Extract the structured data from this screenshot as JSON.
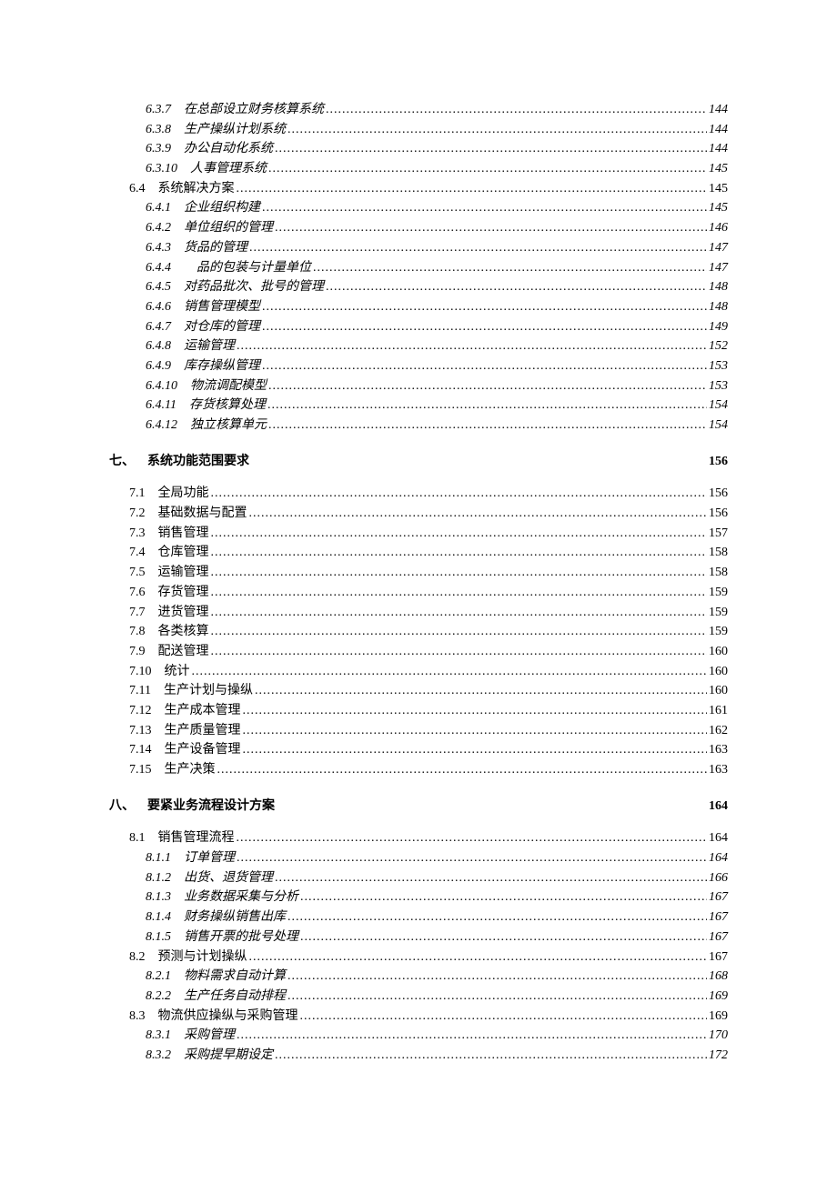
{
  "toc": [
    {
      "level": 3,
      "italic": true,
      "num": "6.3.7",
      "title": "在总部设立财务核算系统",
      "page": "144"
    },
    {
      "level": 3,
      "italic": true,
      "num": "6.3.8",
      "title": "生产操纵计划系统",
      "page": "144"
    },
    {
      "level": 3,
      "italic": true,
      "num": "6.3.9",
      "title": "办公自动化系统",
      "page": "144"
    },
    {
      "level": 3,
      "italic": true,
      "num": "6.3.10",
      "title": "人事管理系统",
      "page": "145"
    },
    {
      "level": 2,
      "italic": false,
      "num": "6.4",
      "title": "系统解决方案",
      "page": "145"
    },
    {
      "level": 3,
      "italic": true,
      "num": "6.4.1",
      "title": "企业组织构建",
      "page": "145"
    },
    {
      "level": 3,
      "italic": true,
      "num": "6.4.2",
      "title": "单位组织的管理",
      "page": "146"
    },
    {
      "level": 3,
      "italic": true,
      "num": "6.4.3",
      "title": "货品的管理",
      "page": "147"
    },
    {
      "level": 3,
      "italic": true,
      "num": "6.4.4",
      "title": "　品的包装与计量单位",
      "page": "147"
    },
    {
      "level": 3,
      "italic": true,
      "num": "6.4.5",
      "title": "对药品批次、批号的管理",
      "page": "148"
    },
    {
      "level": 3,
      "italic": true,
      "num": "6.4.6",
      "title": "销售管理模型",
      "page": "148"
    },
    {
      "level": 3,
      "italic": true,
      "num": "6.4.7",
      "title": "对仓库的管理",
      "page": "149"
    },
    {
      "level": 3,
      "italic": true,
      "num": "6.4.8",
      "title": "运输管理",
      "page": "152"
    },
    {
      "level": 3,
      "italic": true,
      "num": "6.4.9",
      "title": "库存操纵管理",
      "page": "153"
    },
    {
      "level": 3,
      "italic": true,
      "num": "6.4.10",
      "title": "物流调配模型",
      "page": "153"
    },
    {
      "level": 3,
      "italic": true,
      "num": "6.4.11",
      "title": "存货核算处理",
      "page": "154"
    },
    {
      "level": 3,
      "italic": true,
      "num": "6.4.12",
      "title": "独立核算单元",
      "page": "154"
    },
    {
      "level": 1,
      "italic": false,
      "num": "七、",
      "title": "系统功能范围要求",
      "page": "156",
      "gap": true
    },
    {
      "level": 2,
      "italic": false,
      "num": "7.1",
      "title": "全局功能",
      "page": "156",
      "gapafter": true
    },
    {
      "level": 2,
      "italic": false,
      "num": "7.2",
      "title": "基础数据与配置",
      "page": "156"
    },
    {
      "level": 2,
      "italic": false,
      "num": "7.3",
      "title": "销售管理",
      "page": "157"
    },
    {
      "level": 2,
      "italic": false,
      "num": "7.4",
      "title": "仓库管理",
      "page": "158"
    },
    {
      "level": 2,
      "italic": false,
      "num": "7.5",
      "title": "运输管理",
      "page": "158"
    },
    {
      "level": 2,
      "italic": false,
      "num": "7.6",
      "title": "存货管理",
      "page": "159"
    },
    {
      "level": 2,
      "italic": false,
      "num": "7.7",
      "title": "进货管理",
      "page": "159"
    },
    {
      "level": 2,
      "italic": false,
      "num": "7.8",
      "title": "各类核算",
      "page": "159"
    },
    {
      "level": 2,
      "italic": false,
      "num": "7.9",
      "title": "配送管理",
      "page": "160"
    },
    {
      "level": 2,
      "italic": false,
      "num": "7.10",
      "title": "统计",
      "page": "160"
    },
    {
      "level": 2,
      "italic": false,
      "num": "7.11",
      "title": "生产计划与操纵",
      "page": "160"
    },
    {
      "level": 2,
      "italic": false,
      "num": "7.12",
      "title": "生产成本管理",
      "page": "161"
    },
    {
      "level": 2,
      "italic": false,
      "num": "7.13",
      "title": "生产质量管理",
      "page": "162"
    },
    {
      "level": 2,
      "italic": false,
      "num": "7.14",
      "title": "生产设备管理",
      "page": "163"
    },
    {
      "level": 2,
      "italic": false,
      "num": "7.15",
      "title": "生产决策",
      "page": "163"
    },
    {
      "level": 1,
      "italic": false,
      "num": "八、",
      "title": "要紧业务流程设计方案",
      "page": "164",
      "gap": true
    },
    {
      "level": 2,
      "italic": false,
      "num": "8.1",
      "title": "销售管理流程",
      "page": "164",
      "gapafter": true
    },
    {
      "level": 3,
      "italic": true,
      "num": "8.1.1",
      "title": "订单管理",
      "page": "164"
    },
    {
      "level": 3,
      "italic": true,
      "num": "8.1.2",
      "title": "出货、退货管理",
      "page": "166"
    },
    {
      "level": 3,
      "italic": true,
      "num": "8.1.3",
      "title": "业务数据采集与分析",
      "page": "167"
    },
    {
      "level": 3,
      "italic": true,
      "num": "8.1.4",
      "title": "财务操纵销售出库",
      "page": "167"
    },
    {
      "level": 3,
      "italic": true,
      "num": "8.1.5",
      "title": "销售开票的批号处理",
      "page": "167"
    },
    {
      "level": 2,
      "italic": false,
      "num": "8.2",
      "title": "预测与计划操纵",
      "page": "167"
    },
    {
      "level": 3,
      "italic": true,
      "num": "8.2.1",
      "title": "物料需求自动计算",
      "page": "168"
    },
    {
      "level": 3,
      "italic": true,
      "num": "8.2.2",
      "title": "生产任务自动排程",
      "page": "169"
    },
    {
      "level": 2,
      "italic": false,
      "num": "8.3",
      "title": "物流供应操纵与采购管理",
      "page": "169"
    },
    {
      "level": 3,
      "italic": true,
      "num": "8.3.1",
      "title": "采购管理",
      "page": "170"
    },
    {
      "level": 3,
      "italic": true,
      "num": "8.3.2",
      "title": "采购提早期设定",
      "page": "172"
    }
  ]
}
